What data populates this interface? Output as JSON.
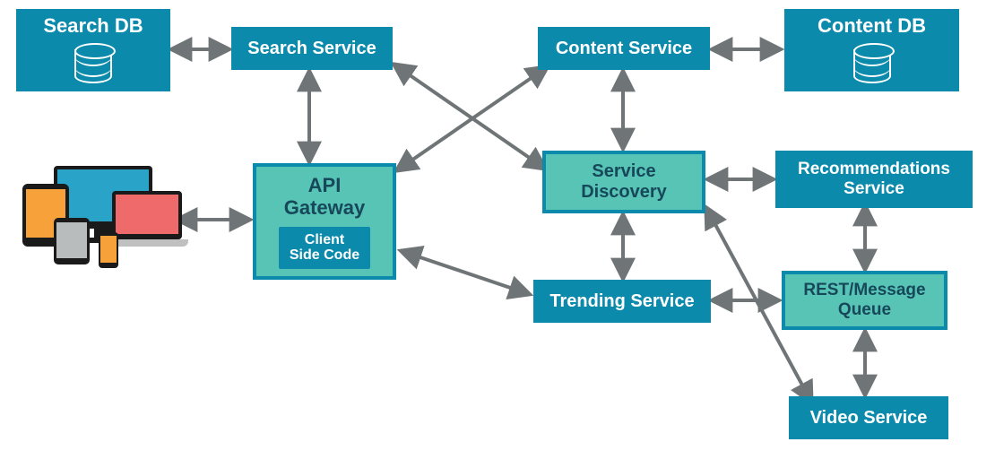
{
  "nodes": {
    "search_db": "Search DB",
    "search_service": "Search Service",
    "content_service": "Content Service",
    "content_db": "Content DB",
    "api_gateway": "API Gateway",
    "client_side_code": "Client Side Code",
    "service_discovery": "Service Discovery",
    "recommendations_service": "Recommendations Service",
    "trending_service": "Trending Service",
    "rest_message_queue": "REST/Message Queue",
    "video_service": "Video Service"
  },
  "colors": {
    "dark": "#0b8aab",
    "light": "#57c4b6",
    "arrow": "#6f7577"
  },
  "edges": [
    [
      "search_db",
      "search_service"
    ],
    [
      "search_service",
      "api_gateway"
    ],
    [
      "devices",
      "api_gateway"
    ],
    [
      "content_service",
      "content_db"
    ],
    [
      "content_service",
      "service_discovery"
    ],
    [
      "service_discovery",
      "recommendations_service"
    ],
    [
      "service_discovery",
      "trending_service"
    ],
    [
      "recommendations_service",
      "rest_message_queue"
    ],
    [
      "trending_service",
      "rest_message_queue"
    ],
    [
      "rest_message_queue",
      "video_service"
    ],
    [
      "api_gateway",
      "content_service"
    ],
    [
      "api_gateway",
      "service_discovery"
    ],
    [
      "api_gateway",
      "trending_service"
    ],
    [
      "service_discovery",
      "video_service"
    ]
  ]
}
